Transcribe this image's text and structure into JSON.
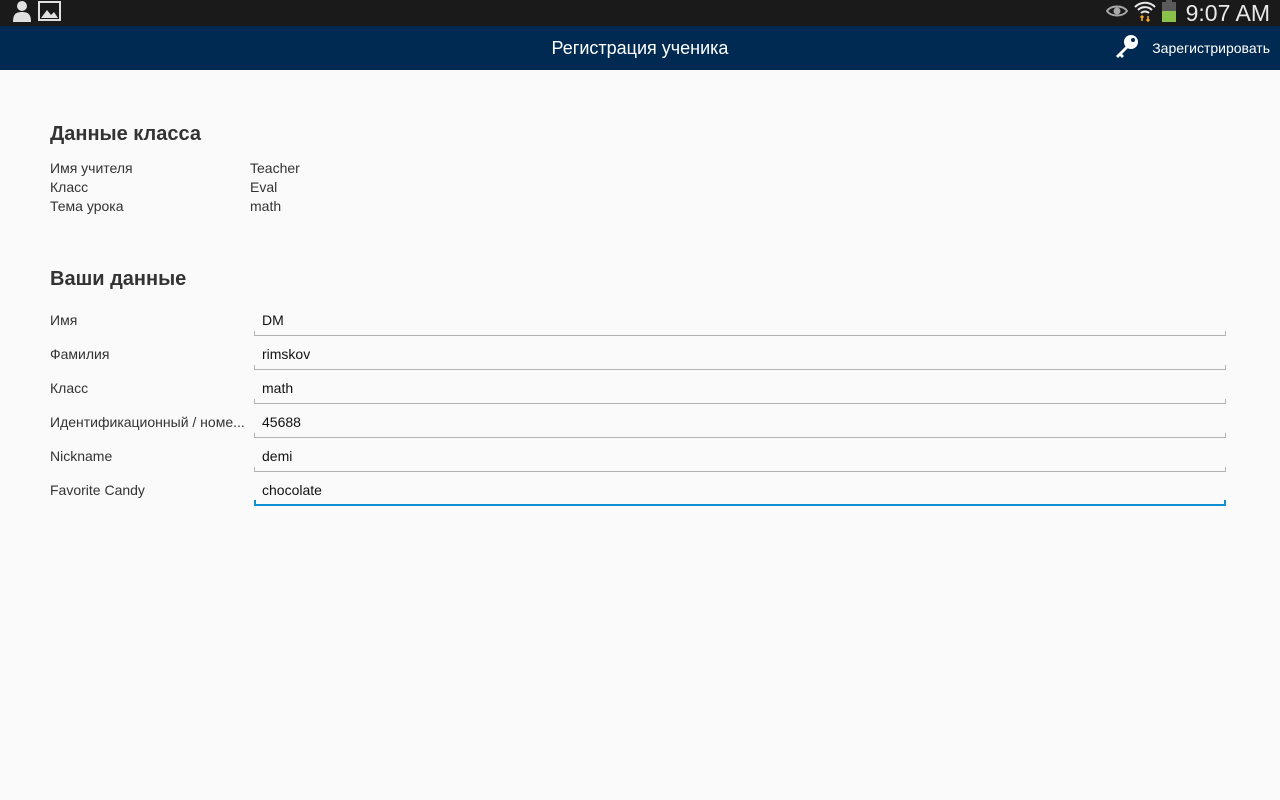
{
  "status_bar": {
    "time": "9:07 AM",
    "left_icons": [
      "person-icon",
      "image-icon"
    ],
    "right_icons": [
      "eye-icon",
      "wifi-icon",
      "battery-icon"
    ],
    "colors": {
      "background": "#1a1a1a",
      "battery": "#8bc34a",
      "wifi_arrows": "#f5a623"
    }
  },
  "action_bar": {
    "title": "Регистрация ученика",
    "action_label": "Зарегистрировать",
    "action_icon": "key-icon",
    "colors": {
      "background": "#002a52"
    }
  },
  "class_section": {
    "title": "Данные класса",
    "rows": [
      {
        "label": "Имя учителя",
        "value": "Teacher"
      },
      {
        "label": "Класс",
        "value": "Eval"
      },
      {
        "label": "Тема урока",
        "value": "math"
      }
    ]
  },
  "user_section": {
    "title": "Ваши данные",
    "fields": [
      {
        "label": "Имя",
        "value": "DM"
      },
      {
        "label": "Фамилия",
        "value": "rimskov"
      },
      {
        "label": "Класс",
        "value": "math"
      },
      {
        "label": "Идентификационный / номе...",
        "value": "45688"
      },
      {
        "label": "Nickname",
        "value": "demi"
      },
      {
        "label": "Favorite Candy",
        "value": "chocolate"
      }
    ],
    "colors": {
      "focus_underline": "#0f8ed1"
    }
  }
}
